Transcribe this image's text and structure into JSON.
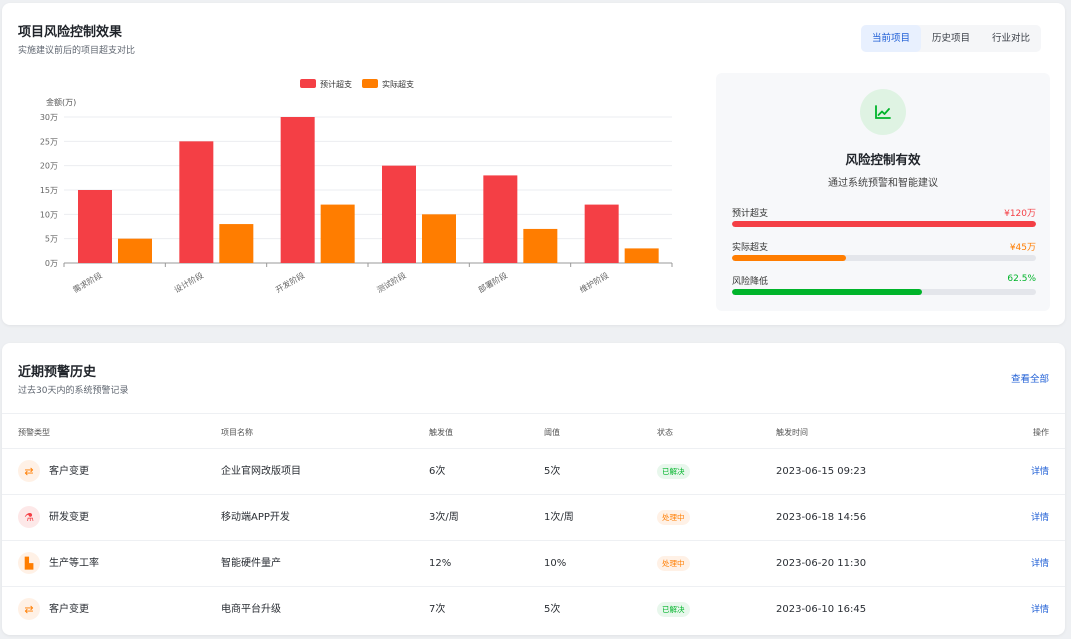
{
  "top": {
    "title": "项目风险控制效果",
    "subtitle": "实施建议前后的项目超支对比",
    "tabs": [
      "当前项目",
      "历史项目",
      "行业对比"
    ],
    "active_tab": 0
  },
  "chart_data": {
    "type": "bar",
    "ylabel": "金额(万)",
    "ylim": [
      0,
      30
    ],
    "yticks": [
      "0万",
      "5万",
      "10万",
      "15万",
      "20万",
      "25万",
      "30万"
    ],
    "categories": [
      "需求阶段",
      "设计阶段",
      "开发阶段",
      "测试阶段",
      "部署阶段",
      "维护阶段"
    ],
    "series": [
      {
        "name": "预计超支",
        "color": "#f43f45",
        "values": [
          15,
          25,
          30,
          20,
          18,
          12
        ]
      },
      {
        "name": "实际超支",
        "color": "#ff7d00",
        "values": [
          5,
          8,
          12,
          10,
          7,
          3
        ]
      }
    ],
    "legend": "top-center",
    "grid": true
  },
  "summary": {
    "icon": "trend-chart-icon",
    "title": "风险控制有效",
    "subtitle": "通过系统预警和智能建议",
    "metrics": [
      {
        "label": "预计超支",
        "value": "¥120万",
        "color": "#f43f45",
        "fraction": 1.0
      },
      {
        "label": "实际超支",
        "value": "¥45万",
        "color": "#ff7d00",
        "fraction": 0.375
      },
      {
        "label": "风险降低",
        "value": "62.5%",
        "color": "#00b42a",
        "fraction": 0.625
      }
    ]
  },
  "history": {
    "title": "近期预警历史",
    "subtitle": "过去30天内的系统预警记录",
    "view_all": "查看全部",
    "columns": [
      "预警类型",
      "项目名称",
      "触发值",
      "阈值",
      "状态",
      "触发时间",
      "操作"
    ],
    "rows": [
      {
        "type": "客户变更",
        "icon": "swap-arrows-icon",
        "icon_color": "#ff7d00",
        "icon_bg": "#fff1e6",
        "project": "企业官网改版项目",
        "trigger": "6次",
        "threshold": "5次",
        "status": "已解决",
        "status_kind": "resolved",
        "time": "2023-06-15 09:23",
        "action": "详情"
      },
      {
        "type": "研发变更",
        "icon": "flask-icon",
        "icon_color": "#f43f45",
        "icon_bg": "#fde8e8",
        "project": "移动端APP开发",
        "trigger": "3次/周",
        "threshold": "1次/周",
        "status": "处理中",
        "status_kind": "processing",
        "time": "2023-06-18 14:56",
        "action": "详情"
      },
      {
        "type": "生产等工率",
        "icon": "factory-icon",
        "icon_color": "#ff7d00",
        "icon_bg": "#fff1e6",
        "project": "智能硬件量产",
        "trigger": "12%",
        "threshold": "10%",
        "status": "处理中",
        "status_kind": "processing",
        "time": "2023-06-20 11:30",
        "action": "详情"
      },
      {
        "type": "客户变更",
        "icon": "swap-arrows-icon",
        "icon_color": "#ff7d00",
        "icon_bg": "#fff1e6",
        "project": "电商平台升级",
        "trigger": "7次",
        "threshold": "5次",
        "status": "已解决",
        "status_kind": "resolved",
        "time": "2023-06-10 16:45",
        "action": "详情"
      }
    ]
  }
}
